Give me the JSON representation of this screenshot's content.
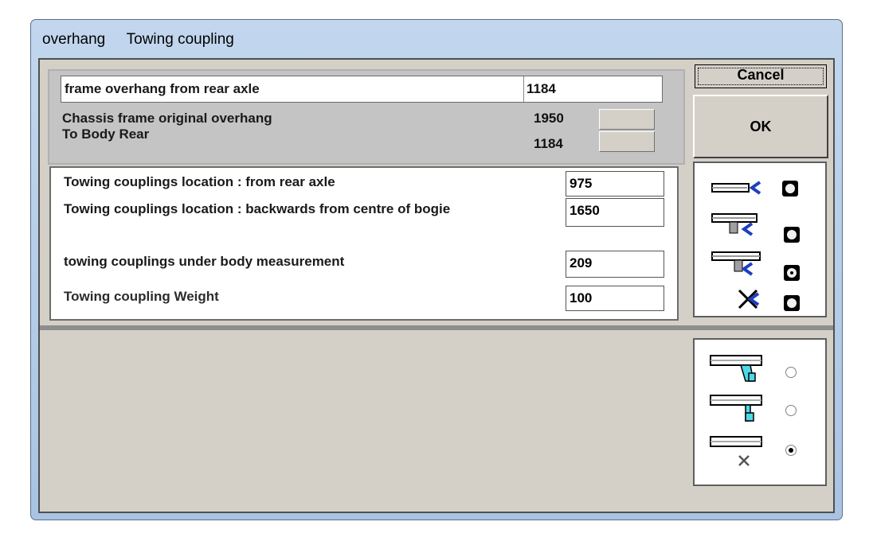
{
  "window": {
    "tabs": [
      "overhang",
      "Towing coupling"
    ]
  },
  "overhang": {
    "frame_label": "frame overhang from rear axle",
    "frame_value": "1184",
    "original_label": "Chassis frame original overhang",
    "original_value": "1950",
    "body_rear_label": "To Body Rear",
    "body_rear_value": "1184"
  },
  "towing": {
    "from_rear_axle_label": "Towing couplings location : from rear axle",
    "from_rear_axle_value": "975",
    "from_bogie_label": "Towing couplings location : backwards from centre of bogie",
    "from_bogie_value": "1650",
    "under_body_label": "towing couplings under body measurement",
    "under_body_value": "209",
    "weight_label": "Towing coupling Weight",
    "weight_value": "100"
  },
  "buttons": {
    "cancel": "Cancel",
    "ok": "OK"
  },
  "coupling_type_options": [
    {
      "icon": "frame-end-coupling-icon",
      "selected": false
    },
    {
      "icon": "drop-bracket-coupling-icon",
      "selected": false
    },
    {
      "icon": "under-body-coupling-icon",
      "selected": true
    },
    {
      "icon": "no-coupling-icon",
      "selected": false
    }
  ],
  "bracket_type_options": [
    {
      "icon": "angled-bracket-icon",
      "selected": false
    },
    {
      "icon": "straight-bracket-icon",
      "selected": false
    },
    {
      "icon": "no-bracket-icon",
      "selected": true
    }
  ],
  "colors": {
    "title_bar": "#b7cde8",
    "client_bg": "#d4d0c8",
    "coupling_blue": "#1e3fbf",
    "bracket_cyan": "#4fd8e8"
  }
}
